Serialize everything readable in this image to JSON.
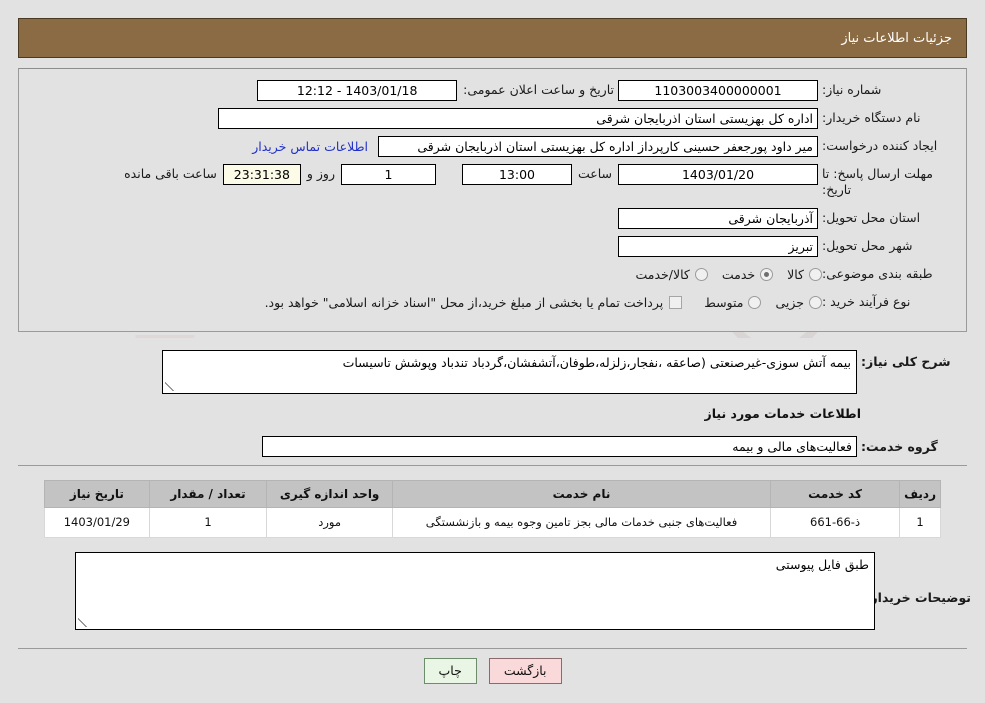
{
  "header": {
    "title": "جزئیات اطلاعات نیاز"
  },
  "top_form": {
    "need_number_label": "شماره نیاز:",
    "need_number_value": "1103003400000001",
    "public_announce_label": "تاریخ و ساعت اعلان عمومی:",
    "public_announce_value": "1403/01/18 - 12:12",
    "buyer_org_label": "نام دستگاه خریدار:",
    "buyer_org_value": "اداره کل بهزیستی استان اذربایجان شرقی",
    "requester_label": "ایجاد کننده درخواست:",
    "requester_value": "میر داود پورجعفر حسینی کارپرداز اداره کل بهزیستی استان اذربایجان شرقی",
    "contact_link": "اطلاعات تماس خریدار",
    "deadline_label": "مهلت ارسال پاسخ: تا تاریخ:",
    "deadline_date": "1403/01/20",
    "hour_label": "ساعت",
    "deadline_time": "13:00",
    "days_value": "1",
    "days_label": "روز و",
    "countdown_value": "23:31:38",
    "remaining_label": "ساعت باقی مانده",
    "province_label": "استان محل تحویل:",
    "province_value": "آذربایجان شرقی",
    "city_label": "شهر محل تحویل:",
    "city_value": "تبریز",
    "category_label": "طبقه بندی موضوعی:",
    "category_options": [
      {
        "label": "کالا",
        "selected": false
      },
      {
        "label": "خدمت",
        "selected": true
      },
      {
        "label": "کالا/خدمت",
        "selected": false
      }
    ],
    "process_label": "نوع فرآیند خرید :",
    "process_options": [
      {
        "label": "جزیی",
        "selected": false
      },
      {
        "label": "متوسط",
        "selected": false
      }
    ],
    "treasury_checkbox_checked": false,
    "treasury_note": "پرداخت تمام یا بخشی از مبلغ خرید،از محل \"اسناد خزانه اسلامی\" خواهد بود."
  },
  "description": {
    "label": "شرح کلی نیاز:",
    "value": "بیمه آتش سوزی-غیرصنعتی (صاعقه ،نفجار،زلزله،طوفان،آتشفشان،گردباد تندباد وپوشش تاسیسات"
  },
  "services_section": {
    "heading": "اطلاعات خدمات مورد نیاز",
    "service_group_label": "گروه خدمت:",
    "service_group_value": "فعالیت‌های مالی و بیمه"
  },
  "items_table": {
    "columns": [
      "ردیف",
      "کد خدمت",
      "نام خدمت",
      "واحد اندازه گیری",
      "تعداد / مقدار",
      "تاریخ نیاز"
    ],
    "rows": [
      {
        "row_no": "1",
        "service_code": "ذ-66-661",
        "service_name": "فعالیت‌های جنبی خدمات مالی بجز تامین وجوه بیمه و بازنشستگی",
        "unit": "مورد",
        "quantity": "1",
        "need_date": "1403/01/29"
      }
    ]
  },
  "buyer_notes": {
    "label": "توضیحات خریدار:",
    "value": "طبق فایل پیوستی"
  },
  "buttons": {
    "print": "چاپ",
    "back": "بازگشت"
  },
  "watermark": {
    "text": "AriaTender.net"
  },
  "colors": {
    "header_brown": "#8b6b43",
    "page_bg": "#e2e2e2",
    "link_blue": "#2030c8",
    "table_header_gray": "#c3c3c3",
    "print_green": "#e9f6e6",
    "back_pink": "#fad9da",
    "countdown_cream": "#fbfbe8"
  }
}
